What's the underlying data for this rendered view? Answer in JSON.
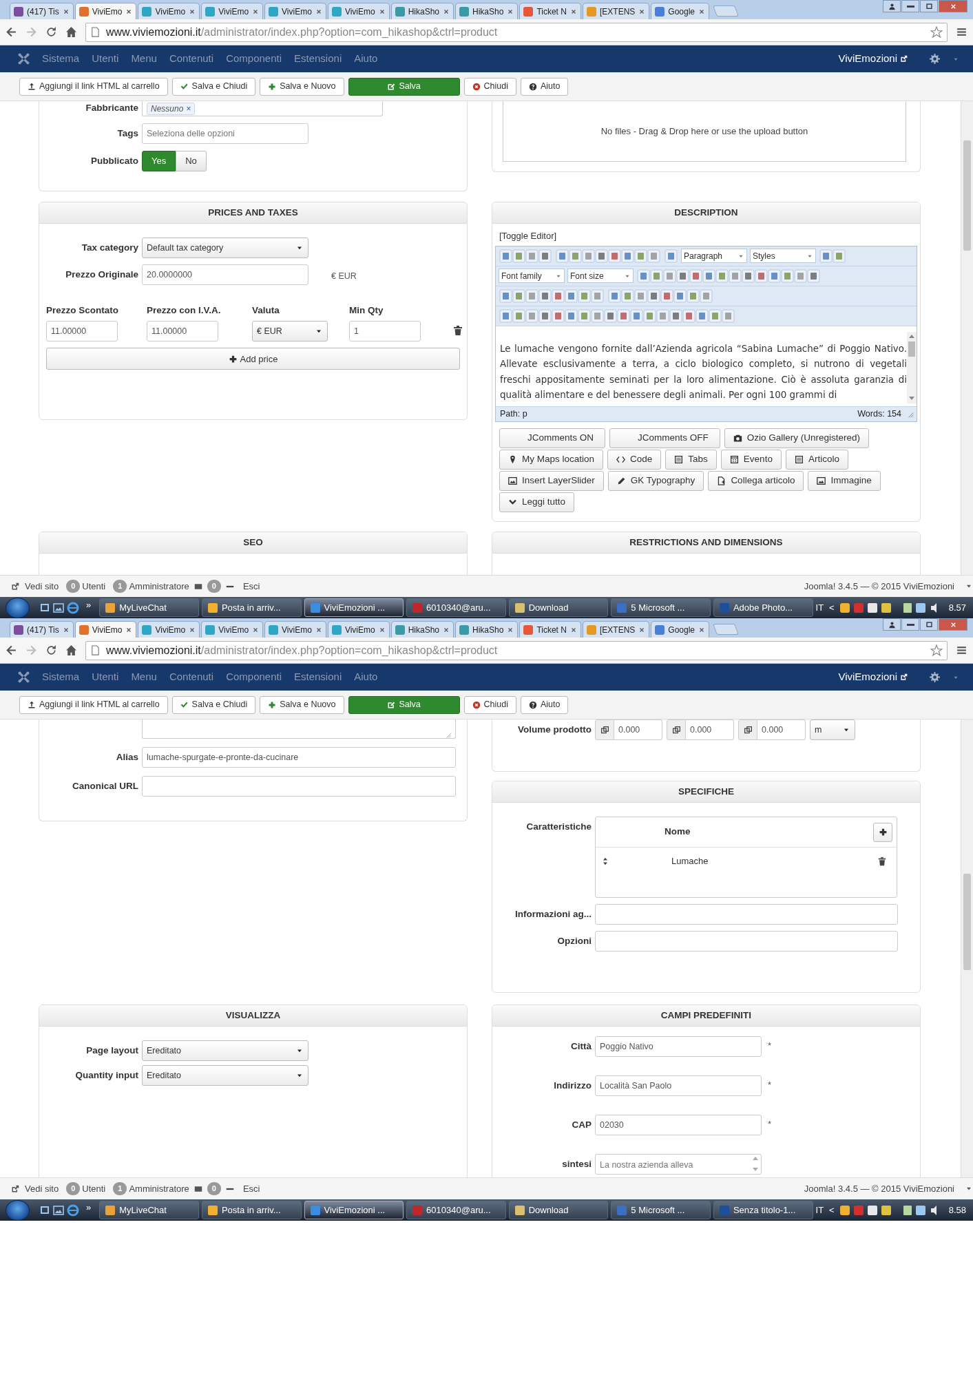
{
  "screens": [
    {
      "browser": {
        "tabs": [
          {
            "label": "(417) Tis",
            "selected": false,
            "color": "#7b4f9e"
          },
          {
            "label": "ViviEmo",
            "selected": true,
            "color": "#e0702c"
          },
          {
            "label": "ViviEmo",
            "selected": false,
            "color": "#2ea6c4"
          },
          {
            "label": "ViviEmo",
            "selected": false,
            "color": "#2ea6c4"
          },
          {
            "label": "ViviEmo",
            "selected": false,
            "color": "#2ea6c4"
          },
          {
            "label": "ViviEmo",
            "selected": false,
            "color": "#2ea6c4"
          },
          {
            "label": "HikaSho",
            "selected": false,
            "color": "#3a9aa6"
          },
          {
            "label": "HikaSho",
            "selected": false,
            "color": "#3a9aa6"
          },
          {
            "label": "Ticket N",
            "selected": false,
            "color": "#e8563a"
          },
          {
            "label": "[EXTENS",
            "selected": false,
            "color": "#e49a22"
          },
          {
            "label": "Google",
            "selected": false,
            "color": "#4a7fd8"
          }
        ],
        "url_host": "www.viviemozioni.it",
        "url_path": "/administrator/index.php?option=com_hikashop&ctrl=product"
      },
      "cms": {
        "menu": [
          "Sistema",
          "Utenti",
          "Menu",
          "Contenuti",
          "Componenti",
          "Estensioni",
          "Aiuto"
        ],
        "site": "ViviEmozioni"
      },
      "toolbar": [
        {
          "kind": "add-link",
          "label": "Aggiungi il link HTML al carrello"
        },
        {
          "kind": "save-close",
          "label": "Salva e Chiudi"
        },
        {
          "kind": "save-new",
          "label": "Salva e Nuovo"
        },
        {
          "kind": "save",
          "label": "Salva"
        },
        {
          "kind": "close",
          "label": "Chiudi"
        },
        {
          "kind": "help",
          "label": "Aiuto"
        }
      ],
      "columns": [
        [
          {
            "open_top": true,
            "fields": [
              {
                "kind": "tags",
                "label": "Fabbricante",
                "tag": "Nessuno",
                "remove": "×"
              },
              {
                "kind": "input",
                "label": "Tags",
                "placeholder": "Seleziona delle opzioni"
              },
              {
                "kind": "toggle",
                "label": "Pubblicato",
                "options": [
                  {
                    "label": "Yes",
                    "selected": true
                  },
                  {
                    "label": "No",
                    "selected": false
                  }
                ]
              }
            ]
          },
          {
            "title": "PRICES AND TAXES",
            "fields": [
              {
                "kind": "select",
                "label": "Tax category",
                "value": "Default tax category"
              },
              {
                "kind": "input",
                "label": "Prezzo Originale",
                "value": "20.0000000",
                "suffix": "€ EUR"
              },
              {
                "kind": "price_table",
                "columns": [
                  "Prezzo Scontato",
                  "Prezzo con I.V.A.",
                  "Valuta",
                  "Min Qty"
                ],
                "row": [
                  "11.00000",
                  "11.00000",
                  "€ EUR",
                  "1"
                ]
              },
              {
                "kind": "button",
                "label": "Add price"
              }
            ]
          },
          {
            "title": "SEO"
          }
        ],
        [
          {
            "open_top": true,
            "fields": [
              {
                "kind": "dropzone",
                "text": "No files - Drag & Drop here or use the upload button"
              }
            ]
          },
          {
            "title": "DESCRIPTION",
            "fields": [
              {
                "kind": "editor",
                "toggle": "[Toggle Editor]",
                "dropdowns": [
                  "Paragraph",
                  "Styles",
                  "Font family",
                  "Font size"
                ],
                "text": "Le lumache vengono fornite dall’Azienda agricola “Sabina Lumache” di Poggio Nativo. Allevate esclusivamente a terra, a ciclo biologico completo, si nutrono di vegetali freschi appositamente seminati per la loro alimentazione. Ciò è assoluta garanzia di qualità alimentare e del benessere degli animali. Per ogni 100 grammi di",
                "path": "Path: p",
                "words": "Words: 154"
              },
              {
                "kind": "buttons",
                "buttons": [
                  {
                    "kind": "plain",
                    "label": "JComments ON"
                  },
                  {
                    "kind": "plain",
                    "label": "JComments OFF"
                  },
                  {
                    "kind": "gallery",
                    "label": "Ozio Gallery (Unregistered)"
                  },
                  {
                    "kind": "map",
                    "label": "My Maps location"
                  },
                  {
                    "kind": "code",
                    "label": "Code"
                  },
                  {
                    "kind": "tabs",
                    "label": "Tabs"
                  },
                  {
                    "kind": "event",
                    "label": "Evento"
                  },
                  {
                    "kind": "article",
                    "label": "Articolo"
                  },
                  {
                    "kind": "slider",
                    "label": "Insert LayerSlider"
                  },
                  {
                    "kind": "typography",
                    "label": "GK Typography"
                  },
                  {
                    "kind": "link",
                    "label": "Collega articolo"
                  },
                  {
                    "kind": "image",
                    "label": "Immagine"
                  },
                  {
                    "kind": "readmore",
                    "label": "Leggi tutto"
                  }
                ]
              }
            ]
          },
          {
            "title": "RESTRICTIONS AND DIMENSIONS"
          }
        ]
      ],
      "status": {
        "items": [
          {
            "kind": "view-site",
            "label": "Vedi sito"
          },
          {
            "kind": "count",
            "badge": "0",
            "label": "Utenti"
          },
          {
            "kind": "count",
            "badge": "1",
            "label": "Amministratore"
          },
          {
            "kind": "messages",
            "badge": "0"
          },
          {
            "kind": "logout",
            "label": "Esci"
          }
        ],
        "footer": "Joomla! 3.4.5 — © 2015 ViviEmozioni"
      },
      "taskbar": {
        "overflow": "»",
        "apps": [
          {
            "kind": "chat",
            "label": "MyLiveChat",
            "selected": false
          },
          {
            "kind": "mail",
            "label": "Posta in arriv...",
            "selected": false
          },
          {
            "kind": "browser",
            "label": "ViviEmozioni ...",
            "selected": true
          },
          {
            "kind": "ftp",
            "label": "6010340@aru...",
            "selected": false
          },
          {
            "kind": "folder",
            "label": "Download",
            "selected": false
          },
          {
            "kind": "word",
            "label": "5 Microsoft ...",
            "selected": false
          },
          {
            "kind": "photoshop",
            "label": "Adobe Photo...",
            "selected": false
          }
        ],
        "language": "IT",
        "tray_toggle": "<",
        "time": "8.57"
      }
    },
    {
      "browser": {
        "tabs": [
          {
            "label": "(417) Tis",
            "selected": false,
            "color": "#7b4f9e"
          },
          {
            "label": "ViviEmo",
            "selected": true,
            "color": "#e0702c"
          },
          {
            "label": "ViviEmo",
            "selected": false,
            "color": "#2ea6c4"
          },
          {
            "label": "ViviEmo",
            "selected": false,
            "color": "#2ea6c4"
          },
          {
            "label": "ViviEmo",
            "selected": false,
            "color": "#2ea6c4"
          },
          {
            "label": "ViviEmo",
            "selected": false,
            "color": "#2ea6c4"
          },
          {
            "label": "HikaSho",
            "selected": false,
            "color": "#3a9aa6"
          },
          {
            "label": "HikaSho",
            "selected": false,
            "color": "#3a9aa6"
          },
          {
            "label": "Ticket N",
            "selected": false,
            "color": "#e8563a"
          },
          {
            "label": "[EXTENS",
            "selected": false,
            "color": "#e49a22"
          },
          {
            "label": "Google",
            "selected": false,
            "color": "#4a7fd8"
          }
        ],
        "url_host": "www.viviemozioni.it",
        "url_path": "/administrator/index.php?option=com_hikashop&ctrl=product"
      },
      "cms": {
        "menu": [
          "Sistema",
          "Utenti",
          "Menu",
          "Contenuti",
          "Componenti",
          "Estensioni",
          "Aiuto"
        ],
        "site": "ViviEmozioni"
      },
      "toolbar": [
        {
          "kind": "add-link",
          "label": "Aggiungi il link HTML al carrello"
        },
        {
          "kind": "save-close",
          "label": "Salva e Chiudi"
        },
        {
          "kind": "save-new",
          "label": "Salva e Nuovo"
        },
        {
          "kind": "save",
          "label": "Salva"
        },
        {
          "kind": "close",
          "label": "Chiudi"
        },
        {
          "kind": "help",
          "label": "Aiuto"
        }
      ],
      "columns": [
        [
          {
            "open_top": true,
            "fields": [
              {
                "kind": "textarea"
              },
              {
                "kind": "input",
                "label": "Alias",
                "value": "lumache-spurgate-e-pronte-da-cucinare"
              },
              {
                "kind": "input",
                "label": "Canonical URL"
              }
            ]
          },
          {
            "title": "VISUALIZZA",
            "fields": [
              {
                "kind": "select",
                "label": "Page layout",
                "value": "Ereditato"
              },
              {
                "kind": "select",
                "label": "Quantity input",
                "value": "Ereditato"
              }
            ]
          }
        ],
        [
          {
            "open_top": true,
            "fields": [
              {
                "kind": "volume",
                "label": "Volume prodotto",
                "values": [
                  "0.000",
                  "0.000",
                  "0.000"
                ],
                "unit": "m"
              }
            ]
          },
          {
            "title": "SPECIFICHE",
            "fields": [
              {
                "kind": "spec_table",
                "label": "Caratteristiche",
                "column": "Nome",
                "rows": [
                  "Lumache"
                ]
              },
              {
                "kind": "input",
                "label": "Informazioni ag..."
              },
              {
                "kind": "input",
                "label": "Opzioni"
              }
            ]
          },
          {
            "title": "CAMPI PREDEFINITI",
            "fields": [
              {
                "kind": "input",
                "label": "Città",
                "value": "Poggio Nativo",
                "required": "*"
              },
              {
                "kind": "input",
                "label": "Indirizzo",
                "value": "Località San Paolo",
                "required": "*"
              },
              {
                "kind": "input",
                "label": "CAP",
                "value": "02030",
                "required": "*"
              },
              {
                "kind": "textarea",
                "label": "sintesi",
                "placeholder": "La nostra azienda alleva"
              }
            ]
          }
        ]
      ],
      "status": {
        "items": [
          {
            "kind": "view-site",
            "label": "Vedi sito"
          },
          {
            "kind": "count",
            "badge": "0",
            "label": "Utenti"
          },
          {
            "kind": "count",
            "badge": "1",
            "label": "Amministratore"
          },
          {
            "kind": "messages",
            "badge": "0"
          },
          {
            "kind": "logout",
            "label": "Esci"
          }
        ],
        "footer": "Joomla! 3.4.5 — © 2015 ViviEmozioni"
      },
      "taskbar": {
        "overflow": "»",
        "apps": [
          {
            "kind": "chat",
            "label": "MyLiveChat",
            "selected": false
          },
          {
            "kind": "mail",
            "label": "Posta in arriv...",
            "selected": false
          },
          {
            "kind": "browser",
            "label": "ViviEmozioni ...",
            "selected": true
          },
          {
            "kind": "ftp",
            "label": "6010340@aru...",
            "selected": false
          },
          {
            "kind": "folder",
            "label": "Download",
            "selected": false
          },
          {
            "kind": "word",
            "label": "5 Microsoft ...",
            "selected": false
          },
          {
            "kind": "photoshop",
            "label": "Senza titolo-1...",
            "selected": false
          }
        ],
        "language": "IT",
        "tray_toggle": "<",
        "time": "8.58"
      }
    }
  ]
}
